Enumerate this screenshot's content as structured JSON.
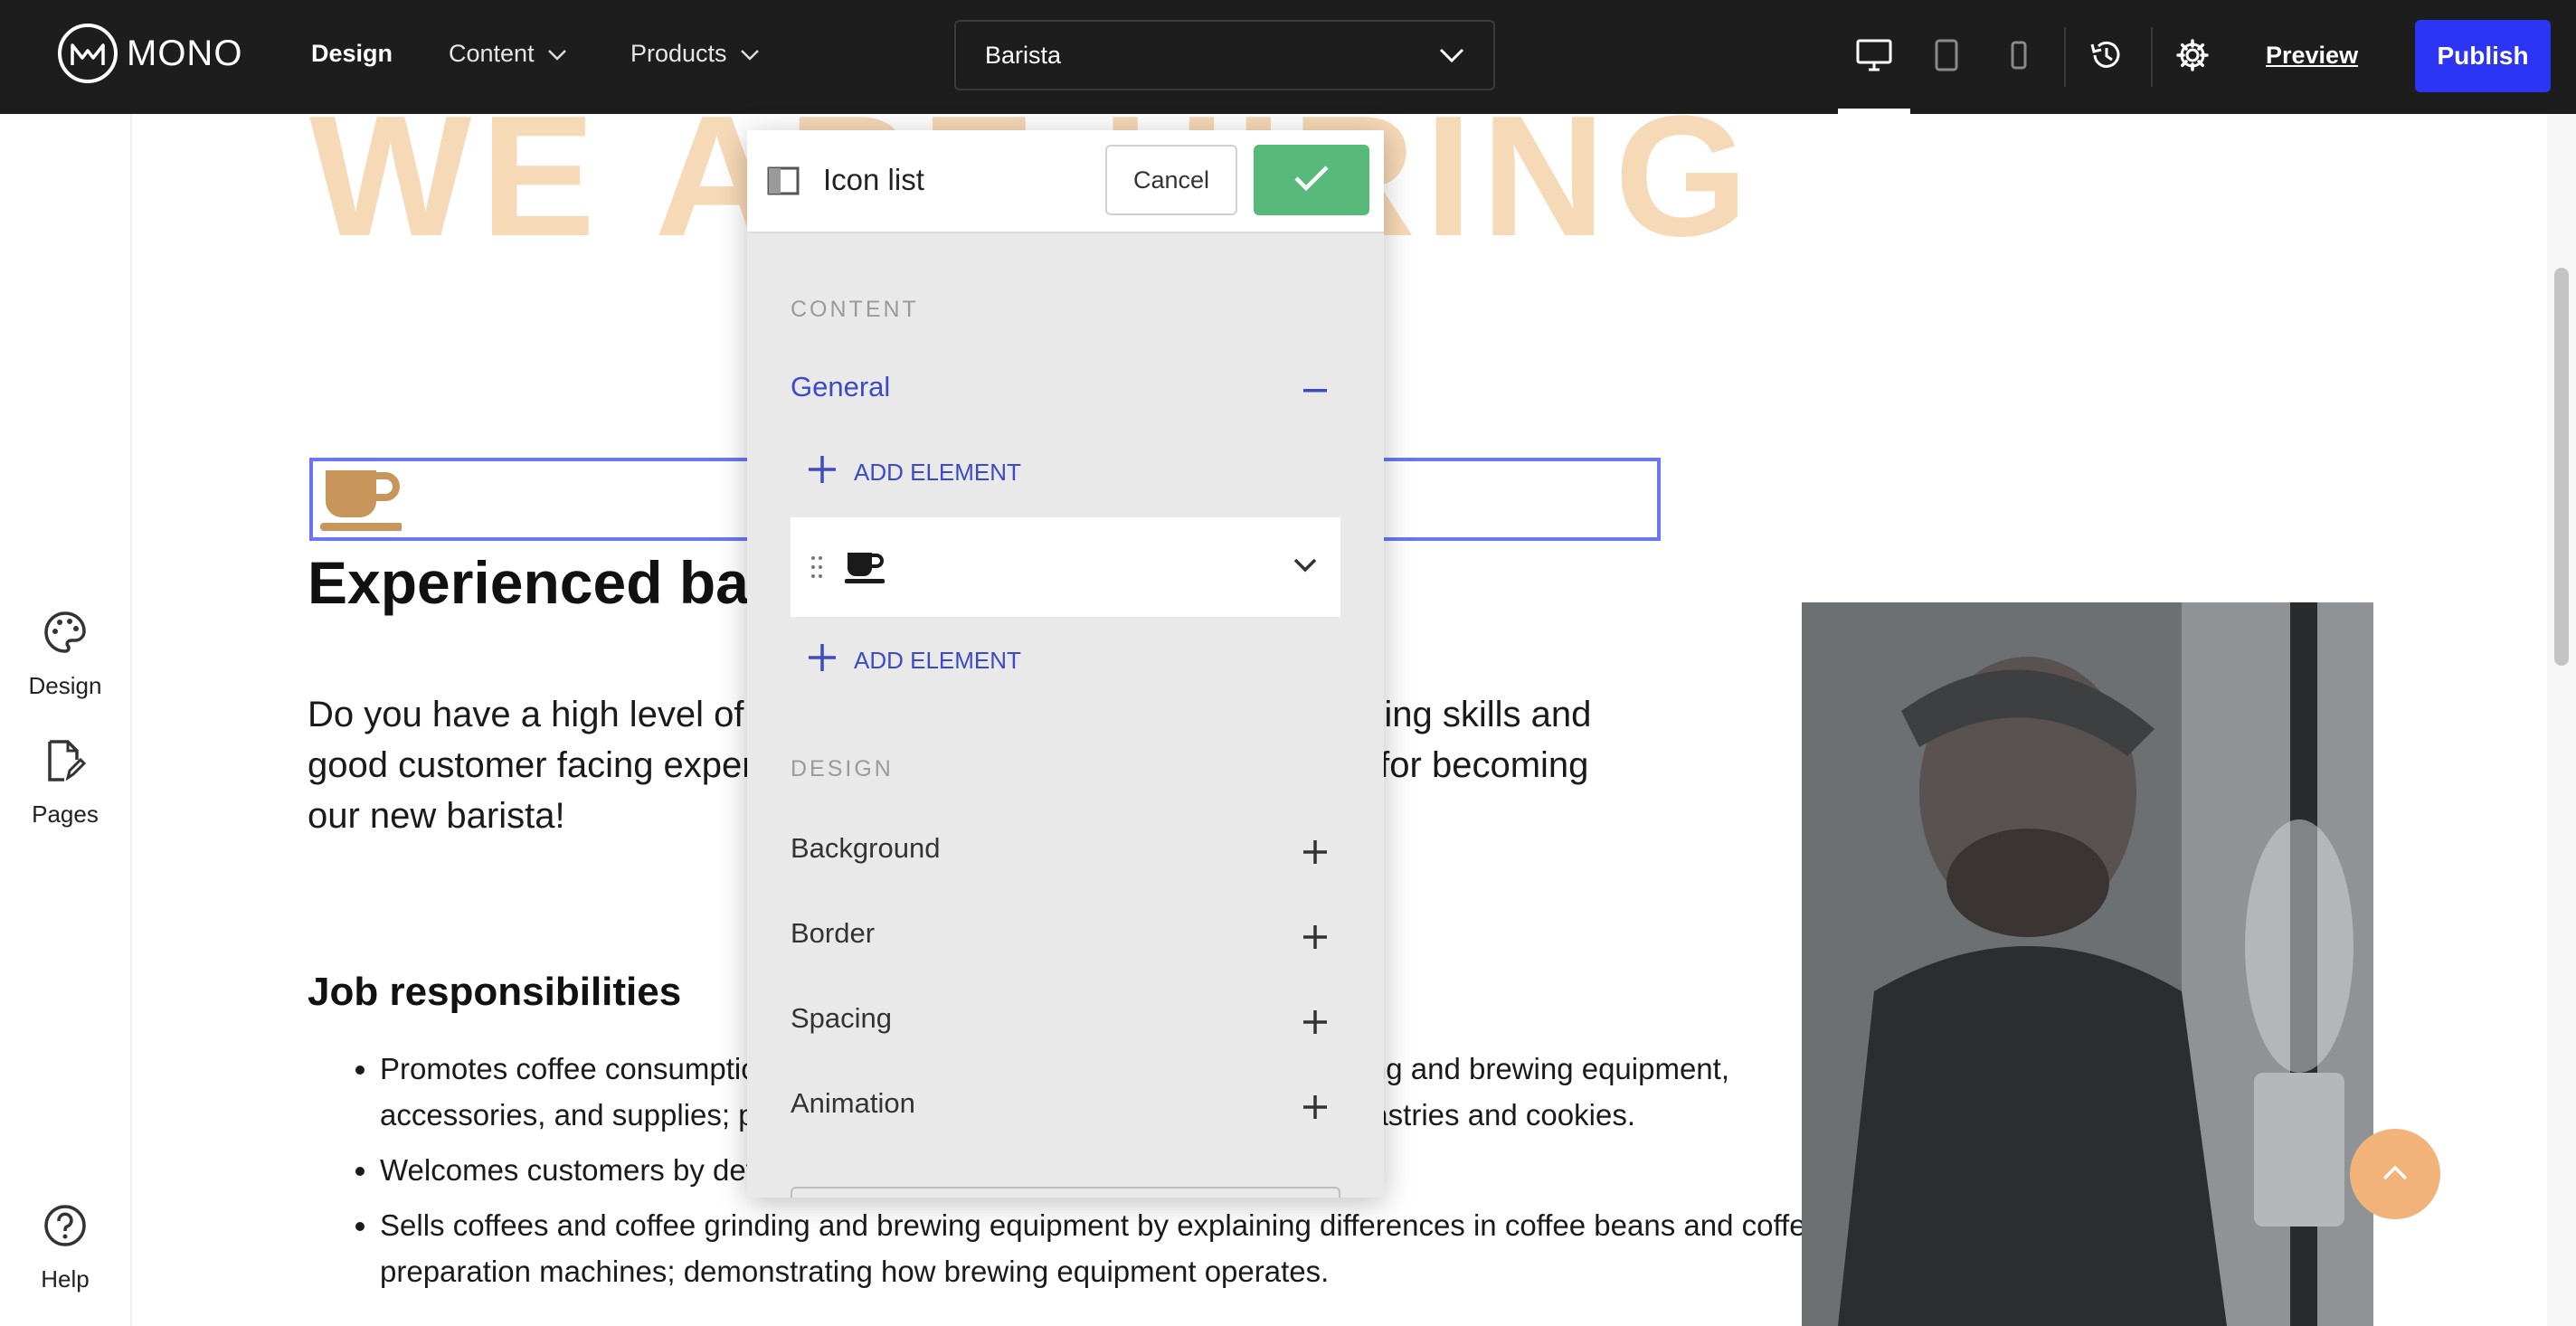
{
  "app": {
    "logo_text": "MONO",
    "nav": {
      "design": "Design",
      "content": "Content",
      "products": "Products"
    },
    "page_select": "Barista",
    "preview": "Preview",
    "publish": "Publish"
  },
  "sidebar": {
    "design": "Design",
    "pages": "Pages",
    "help": "Help"
  },
  "page": {
    "hero": "WE ARE HIRING",
    "job_title": "Experienced barista",
    "intro": "Do you have a high level of coffee knowledge, excellent coffee making skills and good customer facing experience? You might be the perfect match for becoming our new barista!",
    "responsibilities_title": "Job responsibilities",
    "responsibilities": [
      "Promotes coffee consumption by educating customers; selling coffee grinding and brewing equipment, accessories, and supplies; preparing a variety of coffee drinks, along with pastries and cookies.",
      "Welcomes customers by determining their coffee interests and needs.",
      "Sells coffees and coffee grinding and brewing equipment by explaining differences in coffee beans and coffee preparation machines; demonstrating how brewing equipment operates."
    ]
  },
  "panel": {
    "title": "Icon list",
    "cancel": "Cancel",
    "content_label": "CONTENT",
    "general": "General",
    "add_element": "ADD ELEMENT",
    "design_label": "DESIGN",
    "background": "Background",
    "border": "Border",
    "spacing": "Spacing",
    "animation": "Animation"
  },
  "colors": {
    "accent": "#2d35f5",
    "confirm": "#57b97a",
    "link": "#3b4bc8",
    "cup": "#c8955a",
    "hero": "#f6d9b6"
  },
  "icons": [
    "mono-logo-icon",
    "chevron-down-icon",
    "desktop-icon",
    "tablet-icon",
    "mobile-icon",
    "history-icon",
    "gear-icon",
    "palette-icon",
    "pages-icon",
    "help-icon",
    "panel-toggle-icon",
    "check-icon",
    "minus-icon",
    "plus-icon",
    "drag-handle-icon",
    "coffee-cup-icon",
    "chevron-up-icon"
  ]
}
